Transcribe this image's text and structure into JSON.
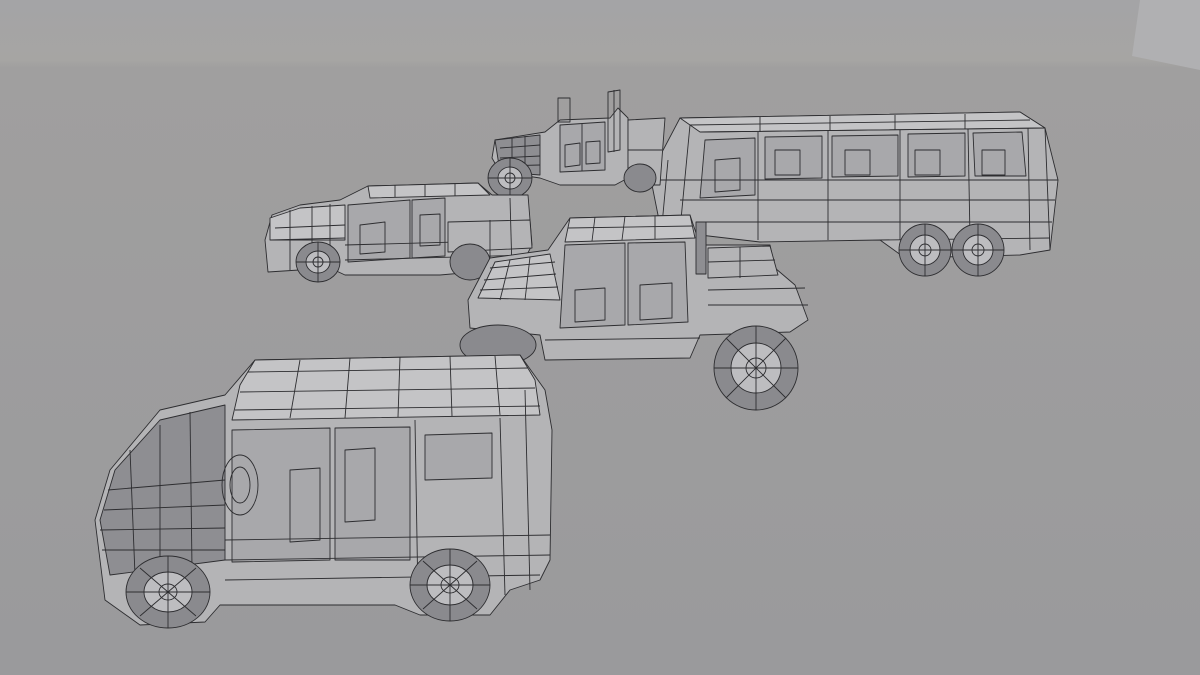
{
  "scene": {
    "type": "3d-viewport-wireframe-render",
    "colors": {
      "sky": "#a2a2a4",
      "horizon": "#a8a6a2",
      "floor": "#9c9c9e",
      "wire": "#2d2d30",
      "body": "#b4b4b6"
    },
    "objects": [
      {
        "id": "limousine-bus",
        "icon": "six-wheel-limo-wireframe"
      },
      {
        "id": "semi-truck-cab",
        "icon": "truck-cab-wireframe"
      },
      {
        "id": "hatchback-sedan",
        "icon": "sedan-wireframe"
      },
      {
        "id": "pickup-truck",
        "icon": "lifted-pickup-wireframe"
      },
      {
        "id": "boxy-van",
        "icon": "van-wireframe"
      }
    ]
  }
}
